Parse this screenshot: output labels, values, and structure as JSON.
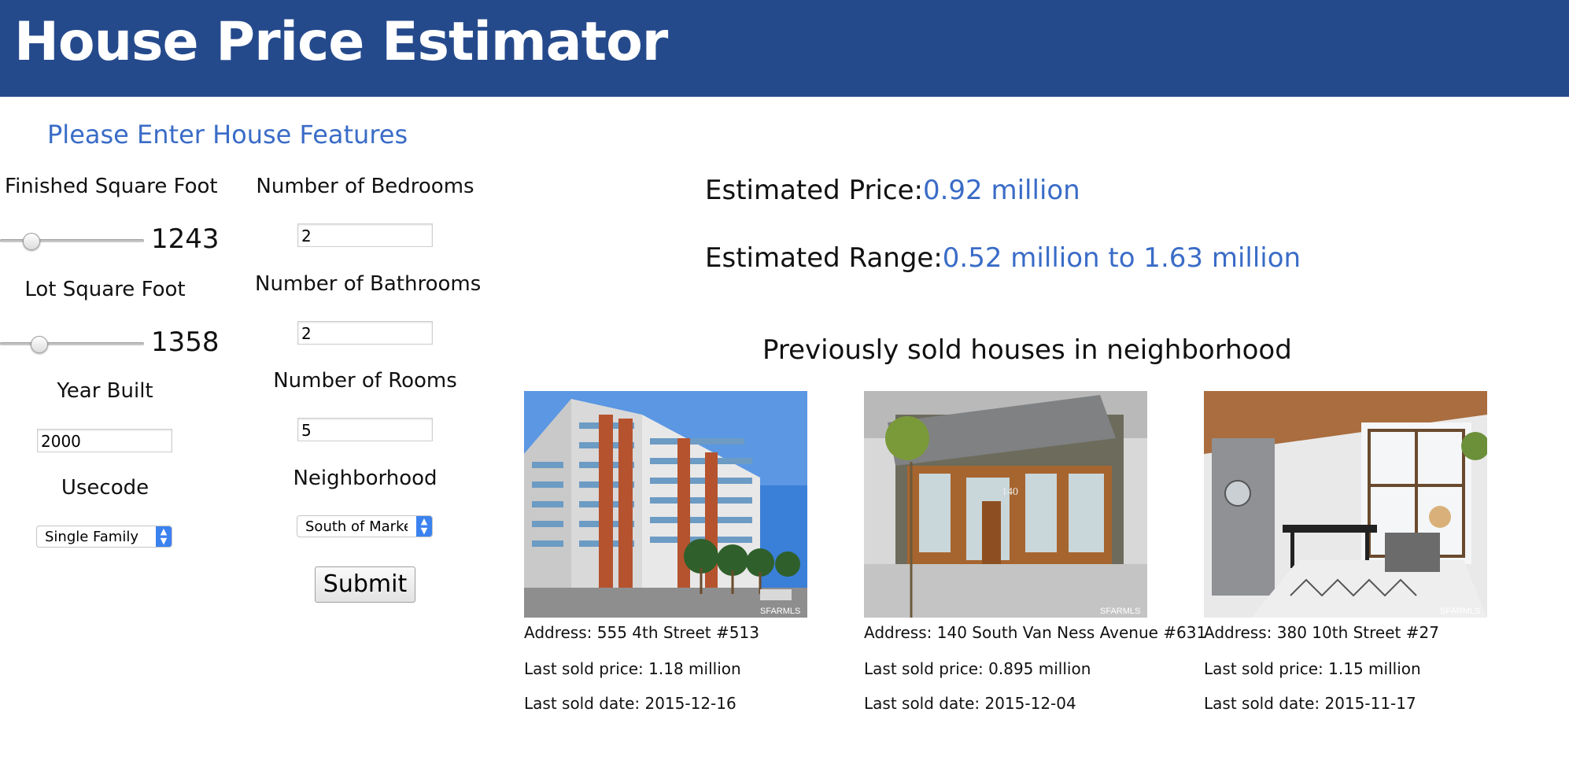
{
  "header": {
    "title": "House Price Estimator"
  },
  "form": {
    "section_title": "Please Enter House Features",
    "sqft": {
      "label": "Finished Square Foot",
      "value": "1243",
      "position_fraction": 0.18
    },
    "lot": {
      "label": "Lot Square Foot",
      "value": "1358",
      "position_fraction": 0.24
    },
    "year": {
      "label": "Year Built",
      "value": "2000"
    },
    "usecode": {
      "label": "Usecode",
      "selected": "Single Family"
    },
    "bedrooms": {
      "label": "Number of Bedrooms",
      "value": "2"
    },
    "bathrooms": {
      "label": "Number of Bathrooms",
      "value": "2"
    },
    "rooms": {
      "label": "Number of Rooms",
      "value": "5"
    },
    "neighborhood": {
      "label": "Neighborhood",
      "selected": "South of Market"
    },
    "submit_label": "Submit"
  },
  "estimate": {
    "price_label": "Estimated Price:",
    "price_value": "0.92 million",
    "range_label": "Estimated Range:",
    "range_value": "0.52 million to 1.63 million"
  },
  "neighborhood_section": {
    "title": "Previously sold houses in neighborhood",
    "houses": [
      {
        "address": "Address: 555 4th Street #513",
        "price": "Last sold price: 1.18 million",
        "date": "Last sold date: 2015-12-16",
        "watermark": "SFARMLS"
      },
      {
        "address": "Address: 140 South Van Ness Avenue #631",
        "price": "Last sold price: 0.895 million",
        "date": "Last sold date: 2015-12-04",
        "watermark": "SFARMLS",
        "sign": "140"
      },
      {
        "address": "Address: 380 10th Street #27",
        "price": "Last sold price: 1.15 million",
        "date": "Last sold date: 2015-11-17",
        "watermark": "SFARMLS"
      }
    ]
  },
  "colors": {
    "header_bg": "#254a8c",
    "accent": "#3a6cc7",
    "select_arrow": "#3b82f0"
  }
}
